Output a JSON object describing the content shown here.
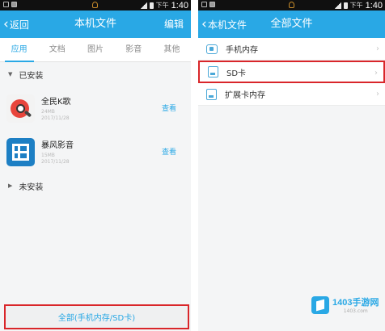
{
  "left": {
    "status": {
      "ampm": "下午",
      "time": "1:40"
    },
    "titlebar": {
      "back_label": "返回",
      "title": "本机文件",
      "edit_label": "编辑"
    },
    "tabs": [
      "应用",
      "文档",
      "图片",
      "影音",
      "其他"
    ],
    "active_tab": "应用",
    "sections": {
      "installed": "已安装",
      "not_installed": "未安装"
    },
    "apps": [
      {
        "name": "全民K歌",
        "meta_line1": "24MB",
        "meta_line2": "2017/11/28",
        "action": "查看",
        "icon": "karaoke-icon"
      },
      {
        "name": "暴风影音",
        "meta_line1": "15MB",
        "meta_line2": "2017/11/28",
        "action": "查看",
        "icon": "storm-film-icon"
      }
    ],
    "bottom_button": "全部(手机内存/SD卡)"
  },
  "right": {
    "status": {
      "ampm": "下午",
      "time": "1:40"
    },
    "titlebar": {
      "back_label": "本机文件",
      "title": "全部文件"
    },
    "storage": [
      {
        "label": "手机内存",
        "icon": "phone-storage-icon"
      },
      {
        "label": "SD卡",
        "icon": "sd-card-icon",
        "highlighted": true
      },
      {
        "label": "扩展卡内存",
        "icon": "extension-card-icon"
      }
    ]
  },
  "watermark": {
    "text": "1403手游网",
    "sub": "1403.com"
  },
  "colors": {
    "accent": "#29a8e5",
    "highlight": "#d9262a",
    "background": "#f4f5f6"
  }
}
